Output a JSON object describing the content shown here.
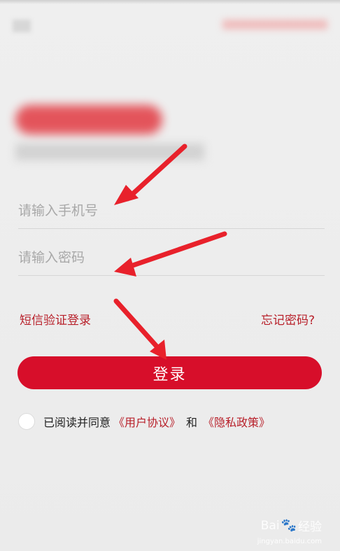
{
  "form": {
    "phone_placeholder": "请输入手机号",
    "password_placeholder": "请输入密码",
    "sms_login_label": "短信验证登录",
    "forgot_password_label": "忘记密码?",
    "login_button_label": "登录"
  },
  "agreement": {
    "prefix": "已阅读并同意",
    "user_agreement": "《用户协议》",
    "conjunction": "和",
    "privacy_policy": "《隐私政策》"
  },
  "watermark": {
    "brand": "Bai",
    "brand_suffix": "经验",
    "url": "jingyan.baidu.com"
  },
  "colors": {
    "accent": "#d70e2a",
    "link": "#b8202a",
    "arrow": "#e8212b"
  }
}
